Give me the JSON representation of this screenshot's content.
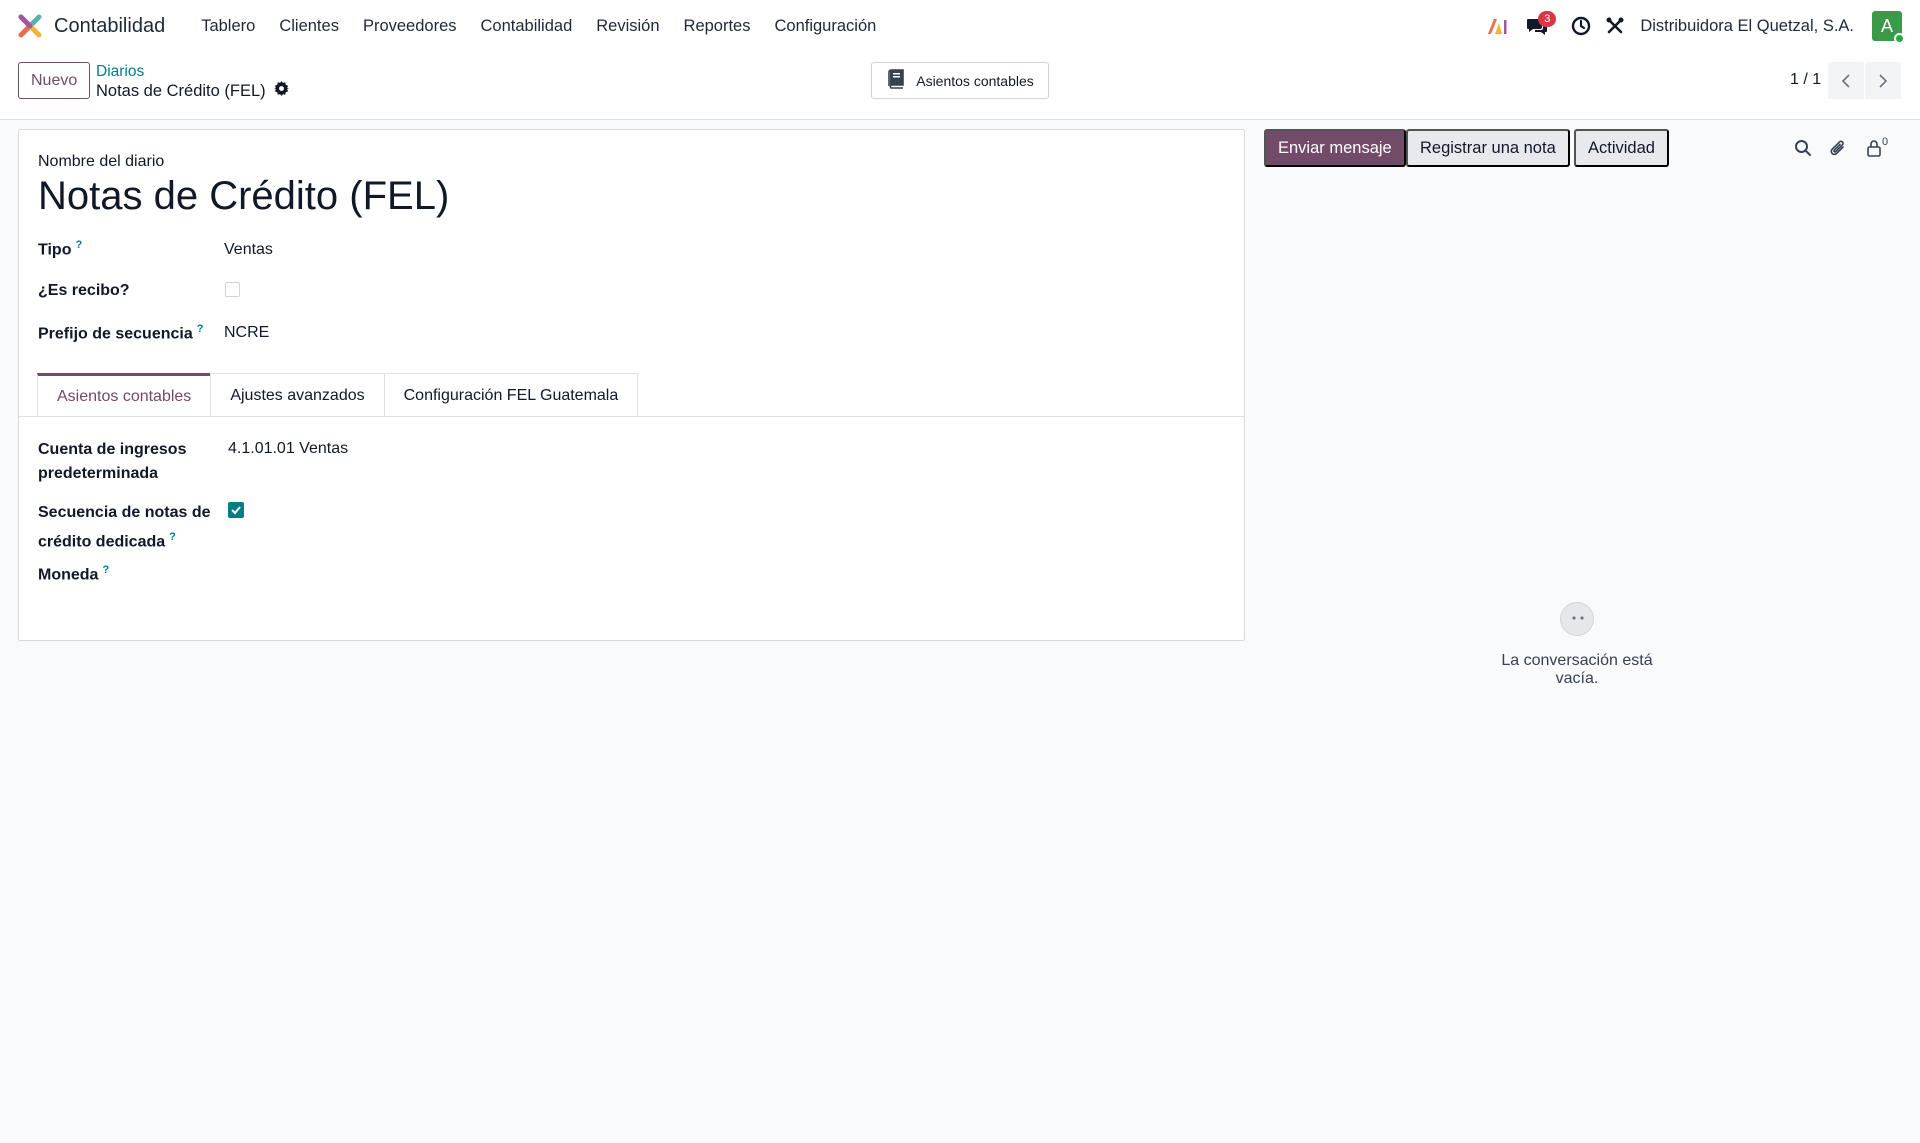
{
  "navbar": {
    "app_name": "Contabilidad",
    "menu": [
      "Tablero",
      "Clientes",
      "Proveedores",
      "Contabilidad",
      "Revisión",
      "Reportes",
      "Configuración"
    ],
    "messages_count": "3",
    "company": "Distribuidora El Quetzal, S.A.",
    "avatar_letter": "A"
  },
  "control": {
    "new_label": "Nuevo",
    "breadcrumb_parent": "Diarios",
    "breadcrumb_current": "Notas de Crédito (FEL)",
    "smart_button_label": "Asientos contables",
    "pager": "1 / 1"
  },
  "form": {
    "name_label": "Nombre del diario",
    "name_value": "Notas de Crédito (FEL)",
    "type_label": "Tipo",
    "type_value": "Ventas",
    "receipt_label": "¿Es recibo?",
    "receipt_checked": false,
    "prefix_label": "Prefijo de secuencia",
    "prefix_value": "NCRE",
    "help_mark": "?",
    "tabs": [
      "Asientos contables",
      "Ajustes avanzados",
      "Configuración FEL Guatemala"
    ],
    "income_account_label_1": "Cuenta de ingresos",
    "income_account_label_2": "predeterminada",
    "income_account_value": "4.1.01.01 Ventas",
    "credit_seq_label_1": "Secuencia de notas de",
    "credit_seq_label_2": "crédito dedicada",
    "credit_seq_checked": true,
    "currency_label": "Moneda"
  },
  "chatter": {
    "send_message": "Enviar mensaje",
    "log_note": "Registrar una nota",
    "activity": "Actividad",
    "followers_count": "0",
    "empty_text": "La conversación está vacía."
  },
  "colors": {
    "primary": "#714b67",
    "teal": "#017e84",
    "badge": "#dc3545",
    "avatar": "#3a9a4a"
  }
}
